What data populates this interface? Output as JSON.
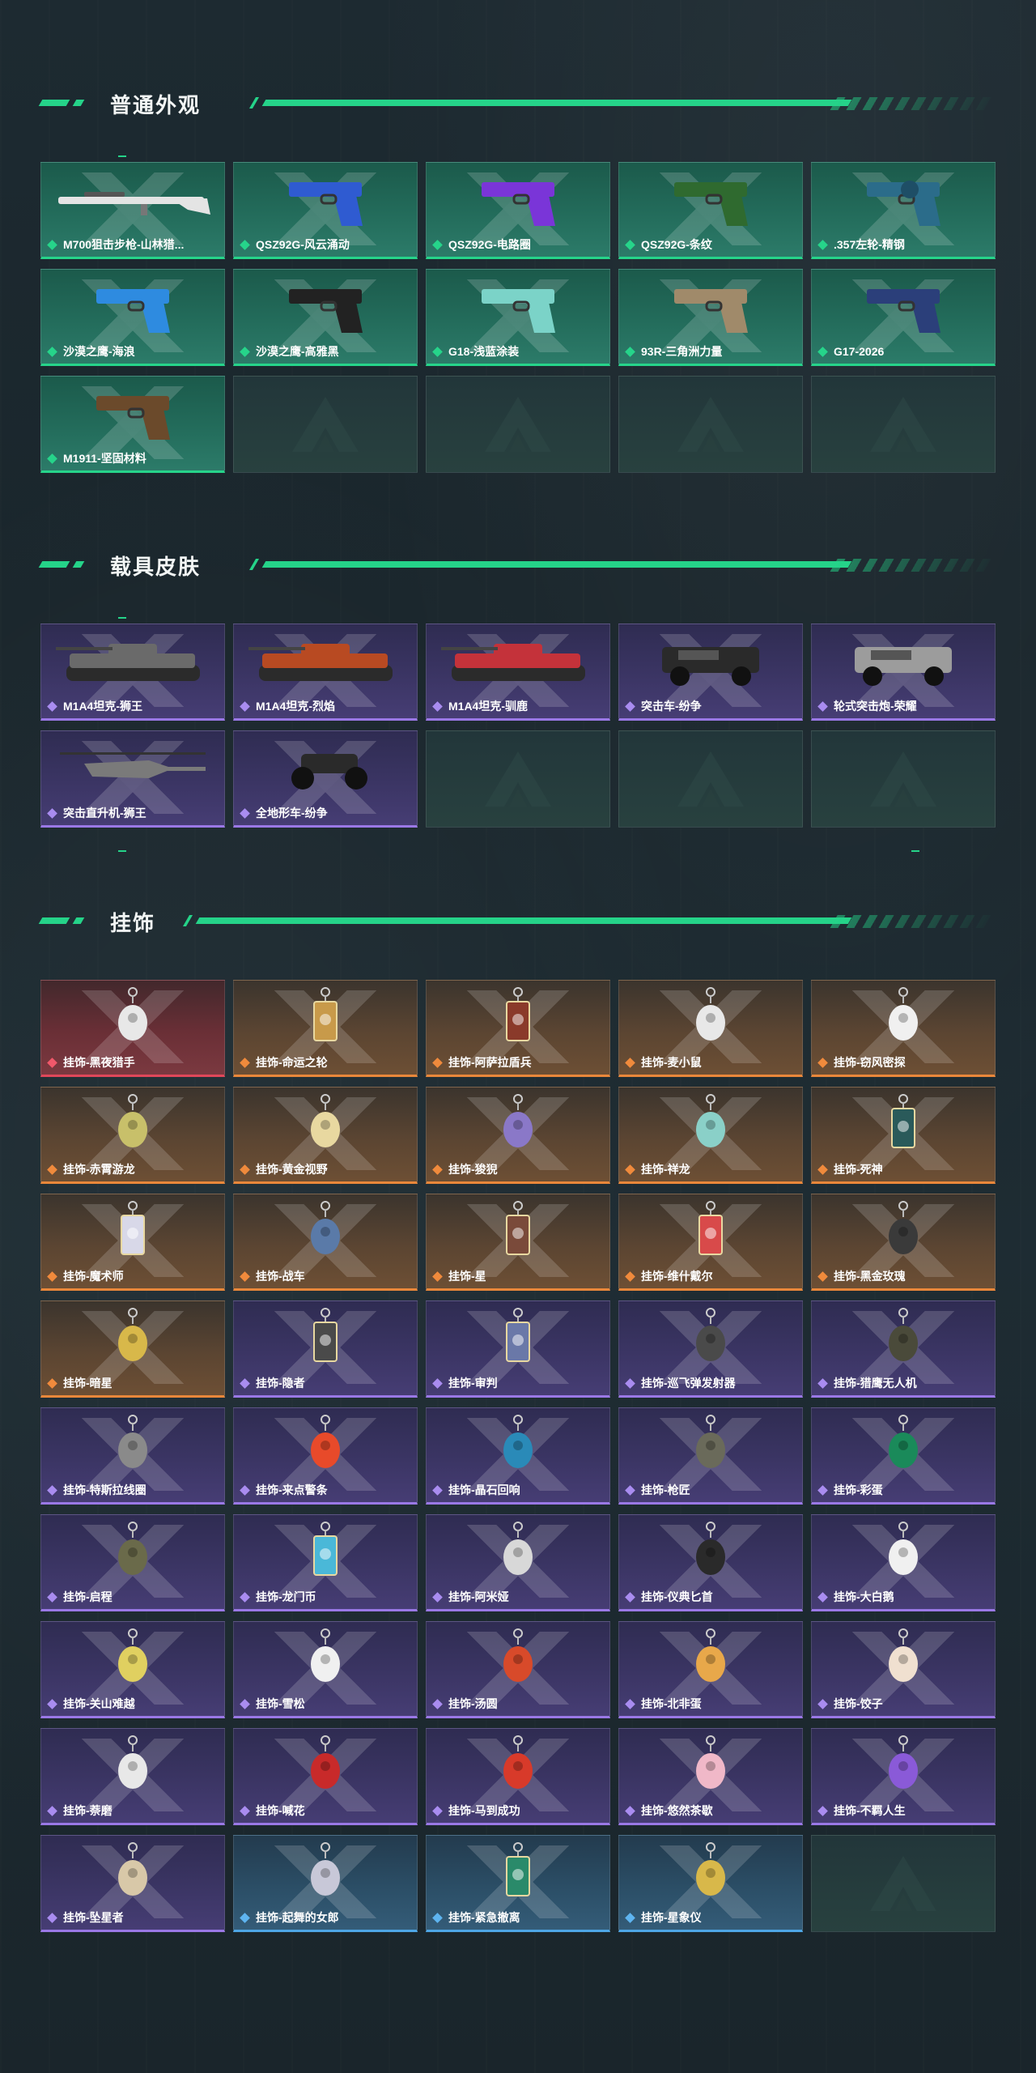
{
  "sections": [
    {
      "title": "普通外观",
      "items": [
        {
          "label": "M700狙击步枪-山林猎...",
          "rarity": "green",
          "art": "rifle",
          "color": "#e4e4e4"
        },
        {
          "label": "QSZ92G-风云涌动",
          "rarity": "green",
          "art": "pistol",
          "color": "#2f5bd1"
        },
        {
          "label": "QSZ92G-电路圈",
          "rarity": "green",
          "art": "pistol",
          "color": "#7a35d8"
        },
        {
          "label": "QSZ92G-条纹",
          "rarity": "green",
          "art": "pistol",
          "color": "#2f6a2f"
        },
        {
          "label": ".357左轮-精钢",
          "rarity": "green",
          "art": "revolver",
          "color": "#2b6c8a"
        },
        {
          "label": "沙漠之鹰-海浪",
          "rarity": "green",
          "art": "pistol",
          "color": "#2e8be0"
        },
        {
          "label": "沙漠之鹰-高雅黑",
          "rarity": "green",
          "art": "pistol",
          "color": "#222222"
        },
        {
          "label": "G18-浅蓝涂装",
          "rarity": "green",
          "art": "pistol",
          "color": "#7bd3c8"
        },
        {
          "label": "93R-三角洲力量",
          "rarity": "green",
          "art": "pistol",
          "color": "#a08a6a"
        },
        {
          "label": "G17-2026",
          "rarity": "green",
          "art": "pistol",
          "color": "#2b3f7a"
        },
        {
          "label": "M1911-坚固材料",
          "rarity": "green",
          "art": "pistol",
          "color": "#6b4a2b"
        },
        {
          "empty": true
        },
        {
          "empty": true
        },
        {
          "empty": true
        },
        {
          "empty": true
        }
      ]
    },
    {
      "title": "载具皮肤",
      "items": [
        {
          "label": "M1A4坦克-狮王",
          "rarity": "purple",
          "art": "tank",
          "color": "#6a6a6a"
        },
        {
          "label": "M1A4坦克-烈焰",
          "rarity": "purple",
          "art": "tank",
          "color": "#b84a22"
        },
        {
          "label": "M1A4坦克-驯鹿",
          "rarity": "purple",
          "art": "tank",
          "color": "#c4323a"
        },
        {
          "label": "突击车-纷争",
          "rarity": "purple",
          "art": "truck",
          "color": "#2a2a2a"
        },
        {
          "label": "轮式突击炮-荣耀",
          "rarity": "purple",
          "art": "truck",
          "color": "#9c9c9c"
        },
        {
          "label": "突击直升机-狮王",
          "rarity": "purple",
          "art": "heli",
          "color": "#7a7a7a"
        },
        {
          "label": "全地形车-纷争",
          "rarity": "purple",
          "art": "atv",
          "color": "#2a2a2a"
        },
        {
          "empty": true
        },
        {
          "empty": true
        },
        {
          "empty": true
        }
      ]
    },
    {
      "title": "挂饰",
      "items": [
        {
          "label": "挂饰-黑夜猎手",
          "rarity": "red",
          "art": "charm",
          "color": "#e8e8e8"
        },
        {
          "label": "挂饰-命运之轮",
          "rarity": "orange",
          "art": "card",
          "color": "#c89a4a"
        },
        {
          "label": "挂饰-阿萨拉盾兵",
          "rarity": "orange",
          "art": "card",
          "color": "#8a3a2a"
        },
        {
          "label": "挂饰-麦小鼠",
          "rarity": "orange",
          "art": "charm",
          "color": "#e8e8e8"
        },
        {
          "label": "挂饰-窃风密探",
          "rarity": "orange",
          "art": "charm",
          "color": "#f0f0f0"
        },
        {
          "label": "挂饰-赤霄游龙",
          "rarity": "orange",
          "art": "charm",
          "color": "#c8c06a"
        },
        {
          "label": "挂饰-黄金视野",
          "rarity": "orange",
          "art": "charm",
          "color": "#e8d8a0"
        },
        {
          "label": "挂饰-狻猊",
          "rarity": "orange",
          "art": "charm",
          "color": "#8a78c8"
        },
        {
          "label": "挂饰-祥龙",
          "rarity": "orange",
          "art": "charm",
          "color": "#8ad0c8"
        },
        {
          "label": "挂饰-死神",
          "rarity": "orange",
          "art": "card",
          "color": "#2a5a5a"
        },
        {
          "label": "挂饰-魔术师",
          "rarity": "orange",
          "art": "card",
          "color": "#d8d8e8"
        },
        {
          "label": "挂饰-战车",
          "rarity": "orange",
          "art": "charm",
          "color": "#5a7aa8"
        },
        {
          "label": "挂饰-星",
          "rarity": "orange",
          "art": "card",
          "color": "#7a4a3a"
        },
        {
          "label": "挂饰-维什戴尔",
          "rarity": "orange",
          "art": "card",
          "color": "#d84a4a"
        },
        {
          "label": "挂饰-黑金玫瑰",
          "rarity": "orange",
          "art": "charm",
          "color": "#3a3a3a"
        },
        {
          "label": "挂饰-暗星",
          "rarity": "orange",
          "art": "charm",
          "color": "#d8b84a"
        },
        {
          "label": "挂饰-隐者",
          "rarity": "purple",
          "art": "card",
          "color": "#4a4a4a"
        },
        {
          "label": "挂饰-审判",
          "rarity": "purple",
          "art": "card",
          "color": "#6a78a8"
        },
        {
          "label": "挂饰-巡飞弹发射器",
          "rarity": "purple",
          "art": "charm",
          "color": "#4a4a4a"
        },
        {
          "label": "挂饰-猎鹰无人机",
          "rarity": "purple",
          "art": "charm",
          "color": "#4a4a3a"
        },
        {
          "label": "挂饰-特斯拉线圈",
          "rarity": "purple",
          "art": "charm",
          "color": "#8a8a8a"
        },
        {
          "label": "挂饰-来点警条",
          "rarity": "purple",
          "art": "charm",
          "color": "#e84a2a"
        },
        {
          "label": "挂饰-晶石回响",
          "rarity": "purple",
          "art": "charm",
          "color": "#2a8ab8"
        },
        {
          "label": "挂饰-枪匠",
          "rarity": "purple",
          "art": "charm",
          "color": "#6a6a5a"
        },
        {
          "label": "挂饰-彩蛋",
          "rarity": "purple",
          "art": "charm",
          "color": "#1a8a5a"
        },
        {
          "label": "挂饰-启程",
          "rarity": "purple",
          "art": "charm",
          "color": "#6a6a4a"
        },
        {
          "label": "挂饰-龙门币",
          "rarity": "purple",
          "art": "card",
          "color": "#4ab8d8"
        },
        {
          "label": "挂饰-阿米娅",
          "rarity": "purple",
          "art": "charm",
          "color": "#d8d8d8"
        },
        {
          "label": "挂饰-仪典匕首",
          "rarity": "purple",
          "art": "charm",
          "color": "#2a2a2a"
        },
        {
          "label": "挂饰-大白鹅",
          "rarity": "purple",
          "art": "charm",
          "color": "#f0f0f0"
        },
        {
          "label": "挂饰-关山难越",
          "rarity": "purple",
          "art": "charm",
          "color": "#e0d060"
        },
        {
          "label": "挂饰-雪松",
          "rarity": "purple",
          "art": "charm",
          "color": "#f0f0f0"
        },
        {
          "label": "挂饰-汤圆",
          "rarity": "purple",
          "art": "charm",
          "color": "#d84a2a"
        },
        {
          "label": "挂饰-北非蛋",
          "rarity": "purple",
          "art": "charm",
          "color": "#e8a84a"
        },
        {
          "label": "挂饰-饺子",
          "rarity": "purple",
          "art": "charm",
          "color": "#f0e0d0"
        },
        {
          "label": "挂饰-萘磨",
          "rarity": "purple",
          "art": "charm",
          "color": "#e8e8e8"
        },
        {
          "label": "挂饰-喊花",
          "rarity": "purple",
          "art": "charm",
          "color": "#c82a2a"
        },
        {
          "label": "挂饰-马到成功",
          "rarity": "purple",
          "art": "charm",
          "color": "#d83a2a"
        },
        {
          "label": "挂饰-悠然茶歇",
          "rarity": "purple",
          "art": "charm",
          "color": "#f0b8c8"
        },
        {
          "label": "挂饰-不羁人生",
          "rarity": "purple",
          "art": "charm",
          "color": "#8a5ad8"
        },
        {
          "label": "挂饰-坠星者",
          "rarity": "purple",
          "art": "charm",
          "color": "#d8c8a8"
        },
        {
          "label": "挂饰-起舞的女郎",
          "rarity": "blue",
          "art": "charm",
          "color": "#c8c8d8"
        },
        {
          "label": "挂饰-紧急撤离",
          "rarity": "blue",
          "art": "card",
          "color": "#2a8a6a"
        },
        {
          "label": "挂饰-星象仪",
          "rarity": "blue",
          "art": "charm",
          "color": "#d8b84a"
        },
        {
          "empty": true
        }
      ]
    }
  ]
}
